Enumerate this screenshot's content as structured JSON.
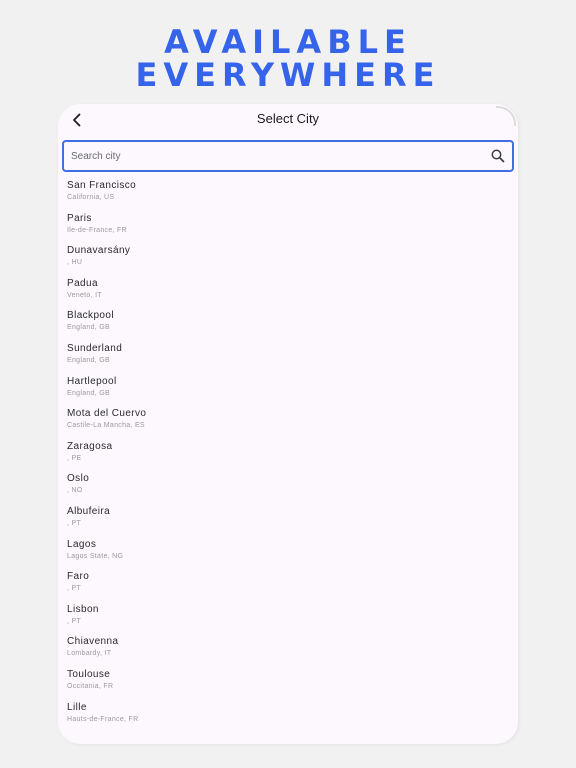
{
  "banner": {
    "line1": "AVAILABLE",
    "line2": "EVERYWHERE"
  },
  "screen": {
    "title": "Select City",
    "back_icon": "chevron-left-icon",
    "search": {
      "placeholder": "Search city",
      "value": "",
      "icon": "search-icon"
    },
    "cities": [
      {
        "name": "San Francisco",
        "region": "California, US"
      },
      {
        "name": "Paris",
        "region": "Ile-de-France, FR"
      },
      {
        "name": "Dunavarsány",
        "region": ", HU"
      },
      {
        "name": "Padua",
        "region": "Veneto, IT"
      },
      {
        "name": "Blackpool",
        "region": "England, GB"
      },
      {
        "name": "Sunderland",
        "region": "England, GB"
      },
      {
        "name": "Hartlepool",
        "region": "England, GB"
      },
      {
        "name": "Mota del Cuervo",
        "region": "Castile-La Mancha, ES"
      },
      {
        "name": "Zaragosa",
        "region": ", PE"
      },
      {
        "name": "Oslo",
        "region": ", NO"
      },
      {
        "name": "Albufeira",
        "region": ", PT"
      },
      {
        "name": "Lagos",
        "region": "Lagos State, NG"
      },
      {
        "name": "Faro",
        "region": ", PT"
      },
      {
        "name": "Lisbon",
        "region": ", PT"
      },
      {
        "name": "Chiavenna",
        "region": "Lombardy, IT"
      },
      {
        "name": "Toulouse",
        "region": "Occitania, FR"
      },
      {
        "name": "Lille",
        "region": "Hauts-de-France, FR"
      }
    ]
  },
  "colors": {
    "accent": "#3563e9",
    "background": "#f1f1f1",
    "surface": "#fcf8fd",
    "search_border": "#3f6fe0"
  }
}
